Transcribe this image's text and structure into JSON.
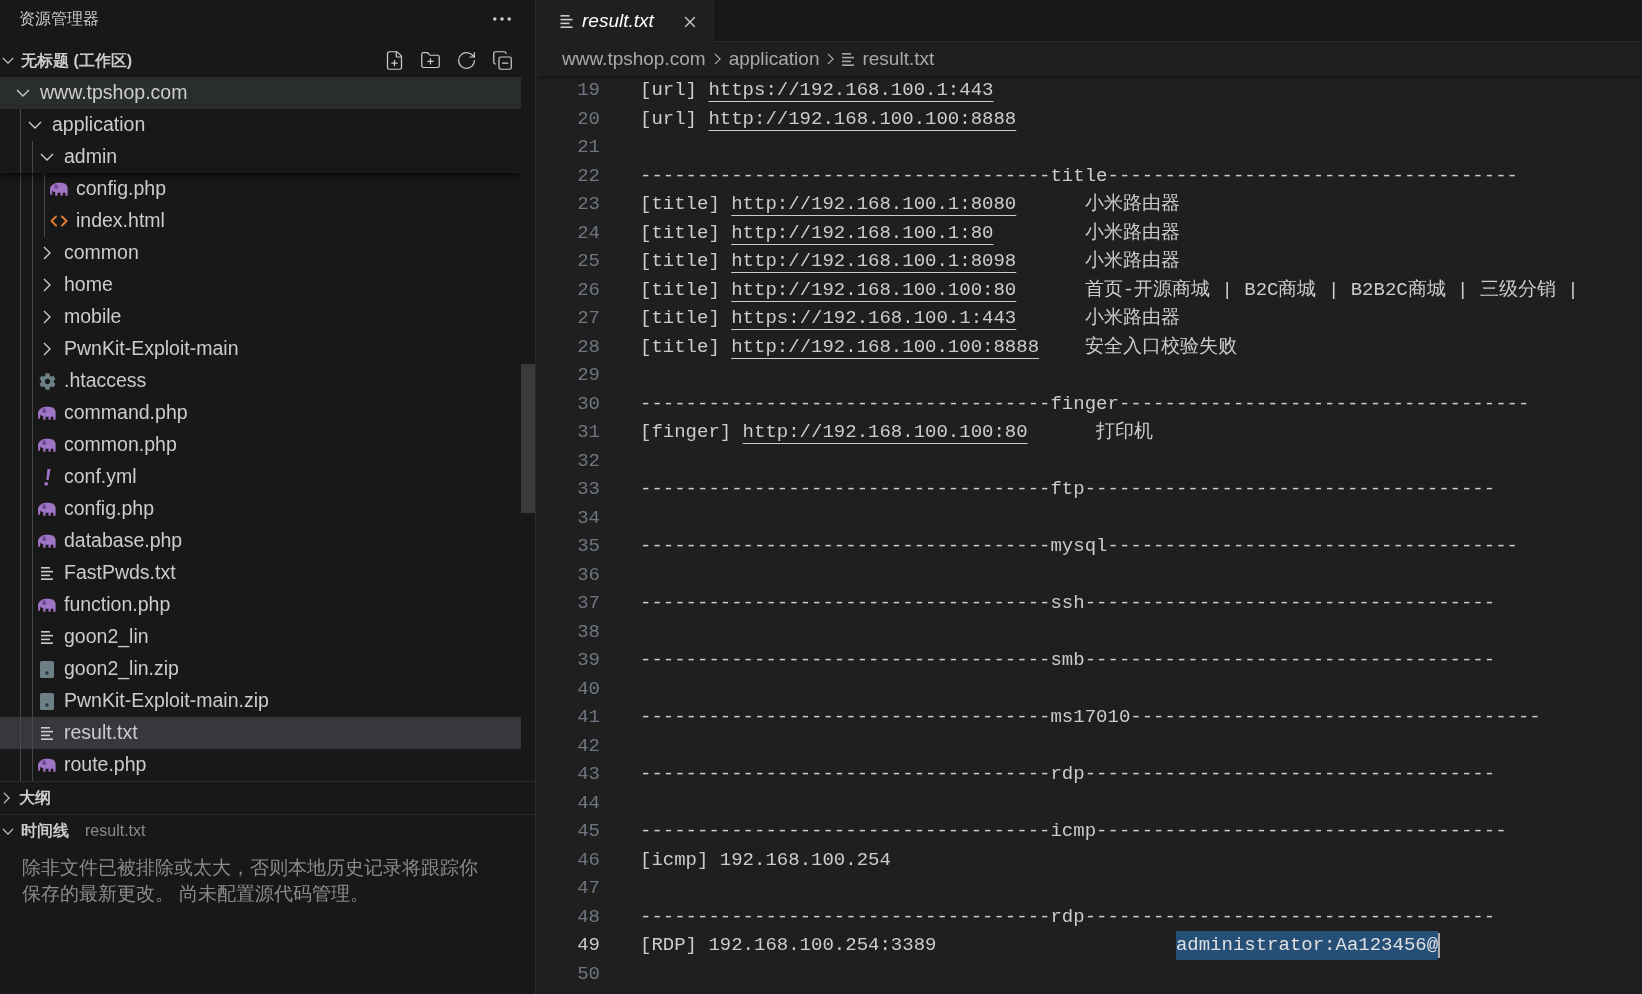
{
  "explorer": {
    "title": "资源管理器",
    "workspace": {
      "label": "无标题 (工作区)",
      "expanded": true
    },
    "tree": [
      {
        "label": "www.tpshop.com",
        "kind": "folder",
        "expanded": true,
        "selected": false,
        "hovered": true,
        "children": [
          {
            "label": "application",
            "kind": "folder",
            "expanded": true,
            "selected": false,
            "hovered": false,
            "children": [
              {
                "label": "admin",
                "kind": "folder",
                "expanded": true,
                "selected": false,
                "hovered": false,
                "children": [
                  {
                    "label": "config.php",
                    "kind": "php",
                    "selected": false,
                    "hovered": false
                  },
                  {
                    "label": "index.html",
                    "kind": "html",
                    "selected": false,
                    "hovered": false
                  }
                ]
              },
              {
                "label": "common",
                "kind": "folder",
                "expanded": false,
                "selected": false,
                "hovered": false
              },
              {
                "label": "home",
                "kind": "folder",
                "expanded": false,
                "selected": false,
                "hovered": false
              },
              {
                "label": "mobile",
                "kind": "folder",
                "expanded": false,
                "selected": false,
                "hovered": false
              },
              {
                "label": "PwnKit-Exploit-main",
                "kind": "folder",
                "expanded": false,
                "selected": false,
                "hovered": false
              },
              {
                "label": ".htaccess",
                "kind": "config",
                "selected": false,
                "hovered": false
              },
              {
                "label": "command.php",
                "kind": "php",
                "selected": false,
                "hovered": false
              },
              {
                "label": "common.php",
                "kind": "php",
                "selected": false,
                "hovered": false
              },
              {
                "label": "conf.yml",
                "kind": "yaml",
                "selected": false,
                "hovered": false
              },
              {
                "label": "config.php",
                "kind": "php",
                "selected": false,
                "hovered": false
              },
              {
                "label": "database.php",
                "kind": "php",
                "selected": false,
                "hovered": false
              },
              {
                "label": "FastPwds.txt",
                "kind": "text",
                "selected": false,
                "hovered": false
              },
              {
                "label": "function.php",
                "kind": "php",
                "selected": false,
                "hovered": false
              },
              {
                "label": "goon2_lin",
                "kind": "text",
                "selected": false,
                "hovered": false
              },
              {
                "label": "goon2_lin.zip",
                "kind": "zip",
                "selected": false,
                "hovered": false
              },
              {
                "label": "PwnKit-Exploit-main.zip",
                "kind": "zip",
                "selected": false,
                "hovered": false
              },
              {
                "label": "result.txt",
                "kind": "text",
                "selected": true,
                "hovered": false
              },
              {
                "label": "route.php",
                "kind": "php",
                "selected": false,
                "hovered": false
              }
            ]
          }
        ]
      }
    ]
  },
  "outline": {
    "label": "大纲",
    "expanded": false
  },
  "timeline": {
    "label": "时间线",
    "expanded": true,
    "file": "result.txt",
    "message": "除非文件已被排除或太大，否则本地历史记录将跟踪你保存的最新更改。 尚未配置源代码管理。"
  },
  "editor": {
    "tabs": [
      {
        "label": "result.txt",
        "kind": "text",
        "selected": true,
        "preview": true
      }
    ],
    "breadcrumbs": [
      {
        "label": "www.tpshop.com",
        "kind": "folder"
      },
      {
        "label": "application",
        "kind": "folder"
      },
      {
        "label": "result.txt",
        "kind": "text"
      }
    ],
    "lines": [
      {
        "number": "19",
        "kind": "entry",
        "tag": "[url]",
        "link": "https://192.168.100.1:443",
        "current": false
      },
      {
        "number": "20",
        "kind": "entry",
        "tag": "[url]",
        "link": "http://192.168.100.100:8888",
        "current": false
      },
      {
        "number": "21",
        "kind": "blank",
        "current": false
      },
      {
        "number": "22",
        "kind": "rule",
        "text": "------------------------------------title------------------------------------",
        "current": false
      },
      {
        "number": "23",
        "kind": "entry",
        "tag": "[title]",
        "link": "http://192.168.100.1:8080",
        "note": "小米路由器",
        "current": false
      },
      {
        "number": "24",
        "kind": "entry",
        "tag": "[title]",
        "link": "http://192.168.100.1:80",
        "note": "小米路由器",
        "current": false
      },
      {
        "number": "25",
        "kind": "entry",
        "tag": "[title]",
        "link": "http://192.168.100.1:8098",
        "note": "小米路由器",
        "current": false
      },
      {
        "number": "26",
        "kind": "entry",
        "tag": "[title]",
        "link": "http://192.168.100.100:80",
        "note": "首页-开源商城 | B2C商城 | B2B2C商城 | 三级分销 |",
        "current": false
      },
      {
        "number": "27",
        "kind": "entry",
        "tag": "[title]",
        "link": "https://192.168.100.1:443",
        "note": "小米路由器",
        "current": false
      },
      {
        "number": "28",
        "kind": "entry",
        "tag": "[title]",
        "link": "http://192.168.100.100:8888",
        "note": "安全入口校验失败",
        "current": false
      },
      {
        "number": "29",
        "kind": "blank",
        "current": false
      },
      {
        "number": "30",
        "kind": "rule",
        "text": "------------------------------------finger------------------------------------",
        "current": false
      },
      {
        "number": "31",
        "kind": "entry",
        "tag": "[finger]",
        "link": "http://192.168.100.100:80",
        "note": "打印机",
        "current": false
      },
      {
        "number": "32",
        "kind": "blank",
        "current": false
      },
      {
        "number": "33",
        "kind": "rule",
        "text": "------------------------------------ftp------------------------------------",
        "current": false
      },
      {
        "number": "34",
        "kind": "blank",
        "current": false
      },
      {
        "number": "35",
        "kind": "rule",
        "text": "------------------------------------mysql------------------------------------",
        "current": false
      },
      {
        "number": "36",
        "kind": "blank",
        "current": false
      },
      {
        "number": "37",
        "kind": "rule",
        "text": "------------------------------------ssh------------------------------------",
        "current": false
      },
      {
        "number": "38",
        "kind": "blank",
        "current": false
      },
      {
        "number": "39",
        "kind": "rule",
        "text": "------------------------------------smb------------------------------------",
        "current": false
      },
      {
        "number": "40",
        "kind": "blank",
        "current": false
      },
      {
        "number": "41",
        "kind": "rule",
        "text": "------------------------------------ms17010------------------------------------",
        "current": false
      },
      {
        "number": "42",
        "kind": "blank",
        "current": false
      },
      {
        "number": "43",
        "kind": "rule",
        "text": "------------------------------------rdp------------------------------------",
        "current": false
      },
      {
        "number": "44",
        "kind": "blank",
        "current": false
      },
      {
        "number": "45",
        "kind": "rule",
        "text": "------------------------------------icmp------------------------------------",
        "current": false
      },
      {
        "number": "46",
        "kind": "entry",
        "tag": "[icmp]",
        "text": "192.168.100.254",
        "current": false
      },
      {
        "number": "47",
        "kind": "blank",
        "current": false
      },
      {
        "number": "48",
        "kind": "rule",
        "text": "------------------------------------rdp------------------------------------",
        "current": false
      },
      {
        "number": "49",
        "kind": "entry",
        "tag": "[RDP]",
        "text": "192.168.100.254:3389",
        "selection": "administrator:Aa123456@",
        "current": true
      },
      {
        "number": "50",
        "kind": "blank",
        "current": false
      }
    ]
  }
}
